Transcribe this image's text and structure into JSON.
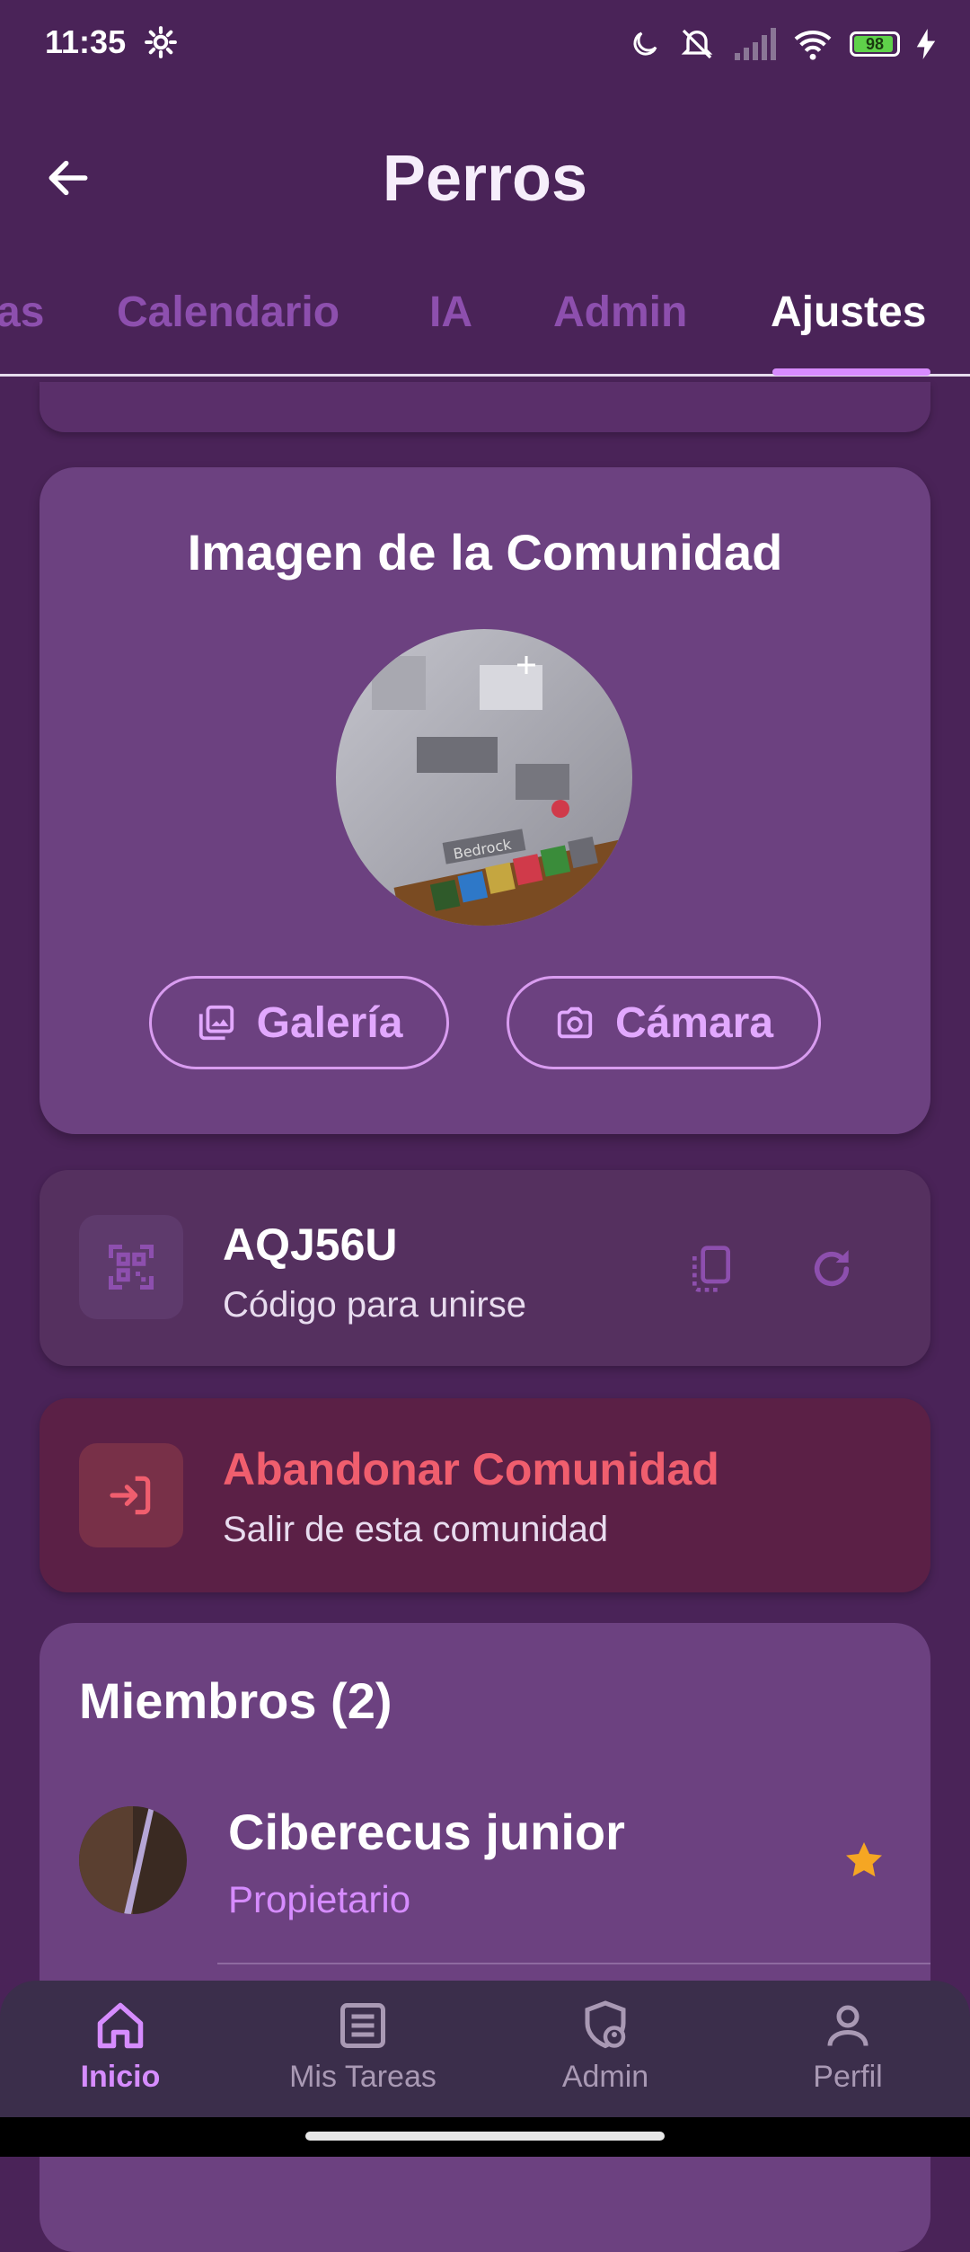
{
  "status_bar": {
    "time": "11:35",
    "battery": "98"
  },
  "header": {
    "title": "Perros",
    "back_icon": "arrow-left-icon"
  },
  "tabs": [
    {
      "label": "as",
      "active": false
    },
    {
      "label": "Calendario",
      "active": false
    },
    {
      "label": "IA",
      "active": false
    },
    {
      "label": "Admin",
      "active": false
    },
    {
      "label": "Ajustes",
      "active": true
    }
  ],
  "image_card": {
    "title": "Imagen de la Comunidad",
    "gallery_label": "Galería",
    "camera_label": "Cámara"
  },
  "code_card": {
    "code": "AQJ56U",
    "label": "Código para unirse"
  },
  "leave_card": {
    "title": "Abandonar Comunidad",
    "subtitle": "Salir de esta comunidad"
  },
  "members": {
    "title": "Miembros (2)",
    "items": [
      {
        "name": "Ciberecus junior",
        "role": "Propietario",
        "owner_star": true
      }
    ]
  },
  "bottom_nav": [
    {
      "label": "Inicio",
      "icon": "home-icon",
      "active": true
    },
    {
      "label": "Mis Tareas",
      "icon": "tasks-icon",
      "active": false
    },
    {
      "label": "Admin",
      "icon": "shield-user-icon",
      "active": false
    },
    {
      "label": "Perfil",
      "icon": "person-icon",
      "active": false
    }
  ],
  "colors": {
    "background": "#4a2358",
    "accent": "#d68cff",
    "danger": "#f05e6e",
    "star": "#f5a623"
  }
}
